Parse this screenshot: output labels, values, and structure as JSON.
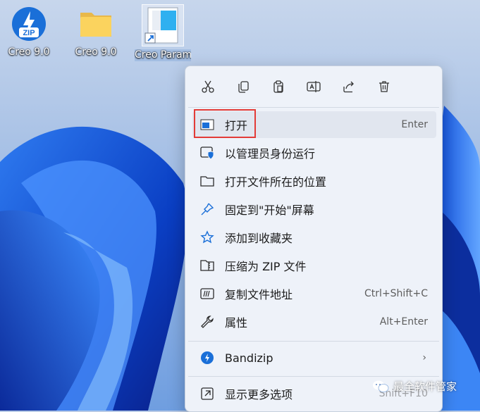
{
  "desktop": {
    "icons": [
      {
        "label": "Creo 9.0",
        "type": "zip-archive"
      },
      {
        "label": "Creo 9.0",
        "type": "folder"
      },
      {
        "label": "Creo Parametr...",
        "type": "shortcut"
      }
    ]
  },
  "context_menu": {
    "quick_actions": [
      "cut-icon",
      "copy-icon",
      "paste-icon",
      "rename-icon",
      "share-icon",
      "delete-icon"
    ],
    "items": [
      {
        "label": "打开",
        "shortcut": "Enter",
        "icon": "open-window-icon"
      },
      {
        "label": "以管理员身份运行",
        "shortcut": "",
        "icon": "shield-icon"
      },
      {
        "label": "打开文件所在的位置",
        "shortcut": "",
        "icon": "folder-icon"
      },
      {
        "label": "固定到\"开始\"屏幕",
        "shortcut": "",
        "icon": "pin-icon"
      },
      {
        "label": "添加到收藏夹",
        "shortcut": "",
        "icon": "star-icon"
      },
      {
        "label": "压缩为 ZIP 文件",
        "shortcut": "",
        "icon": "zip-folder-icon"
      },
      {
        "label": "复制文件地址",
        "shortcut": "Ctrl+Shift+C",
        "icon": "copy-path-icon"
      },
      {
        "label": "属性",
        "shortcut": "Alt+Enter",
        "icon": "wrench-icon"
      },
      {
        "label": "Bandizip",
        "shortcut": "",
        "icon": "bandizip-icon"
      },
      {
        "label": "显示更多选项",
        "shortcut": "Shift+F10",
        "icon": "more-options-icon"
      }
    ],
    "highlighted_item": "打开"
  },
  "watermark": {
    "text": "最全软件管家"
  },
  "colors": {
    "accent": "#1a6fd8",
    "highlight_border": "#e33b37"
  }
}
